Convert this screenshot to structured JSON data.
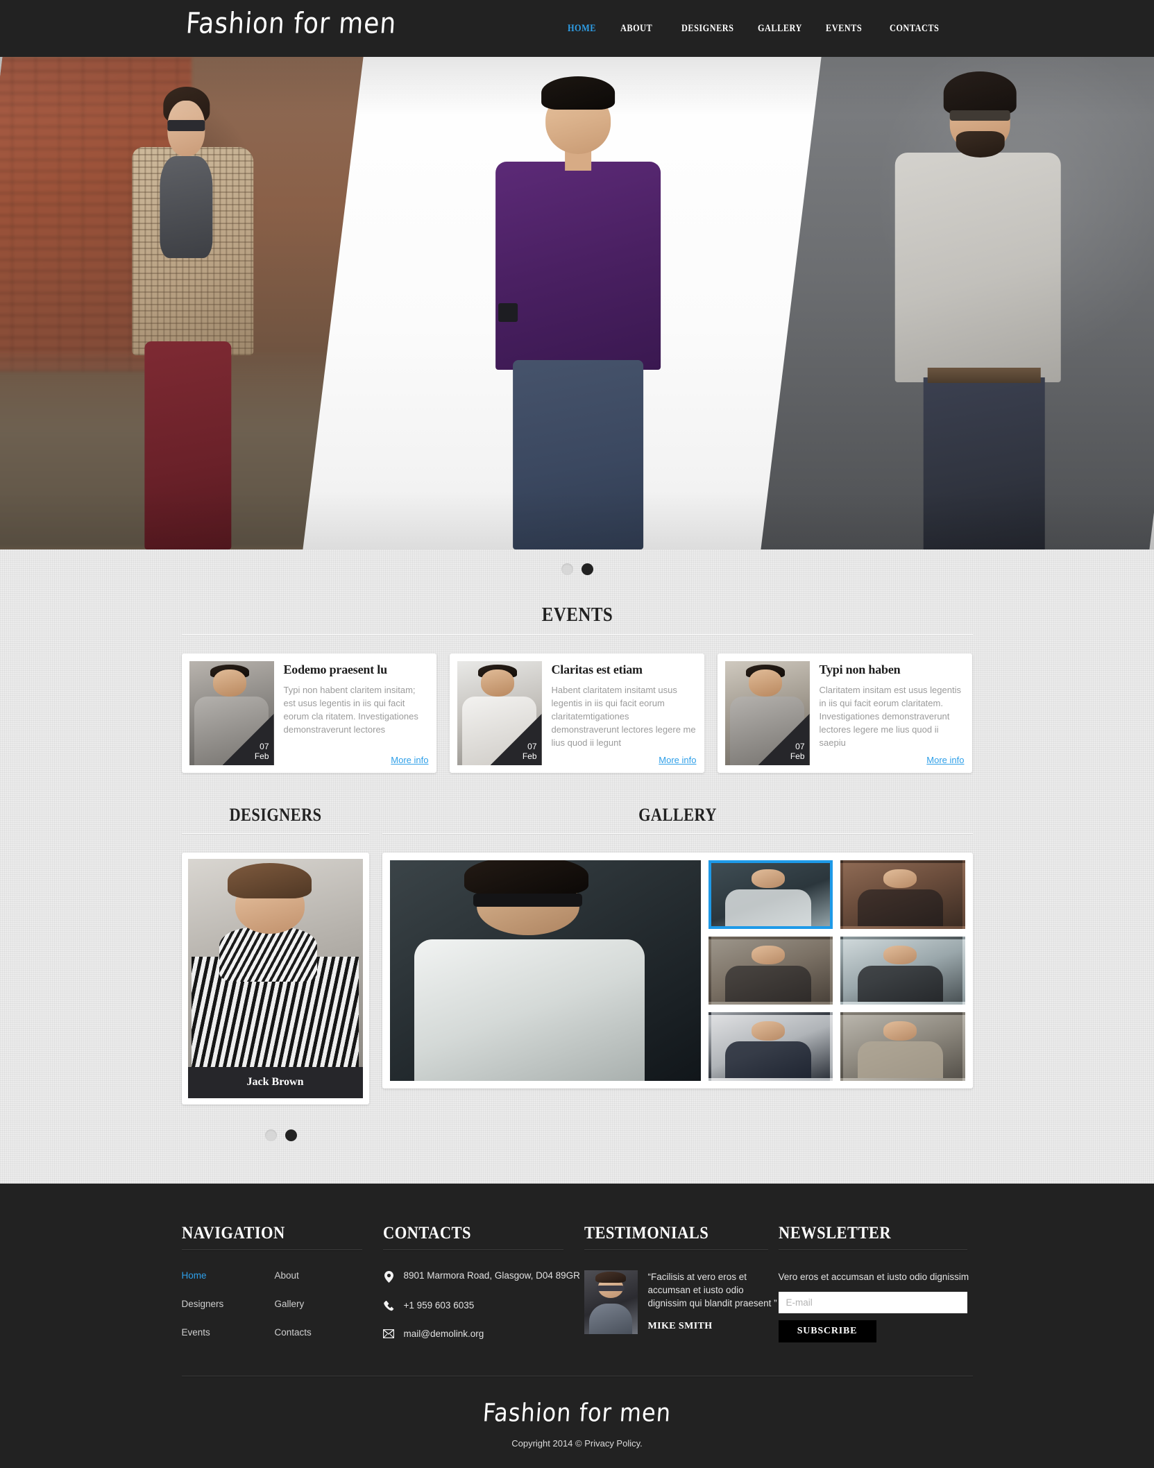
{
  "site": {
    "brand": "Fashion for men",
    "footer_brand": "Fashion for men",
    "copyright": "Copyright 2014 © Privacy Policy.",
    "accent_color": "#2e9fe8",
    "dark_color": "#222222",
    "bg_color": "#ececec"
  },
  "nav": {
    "items": [
      {
        "label": "HOME",
        "active": true
      },
      {
        "label": "ABOUT",
        "active": false
      },
      {
        "label": "DESIGNERS",
        "active": false
      },
      {
        "label": "GALLERY",
        "active": false
      },
      {
        "label": "EVENTS",
        "active": false
      },
      {
        "label": "CONTACTS",
        "active": false
      }
    ]
  },
  "hero": {
    "slides": [
      {
        "alt": "Man in checked blazer and maroon trousers on a brick street"
      },
      {
        "alt": "Man in open purple shirt and jeans on white studio backdrop"
      },
      {
        "alt": "Bearded man in grey cardigan against grey wall"
      }
    ],
    "pager": {
      "dots": 2,
      "active_index": 1
    }
  },
  "events": {
    "title": "EVENTS",
    "cards": [
      {
        "title": "Eodemo praesent lu",
        "text": "Typi non habent claritem insitam; est usus legentis in iis qui facit eorum cla ritatem. Investigationes demonstraverunt lectores",
        "day": "07",
        "month": "Feb",
        "link": "More info",
        "image_alt": "Man in grey knit cardigan"
      },
      {
        "title": "Claritas est etiam",
        "text": "Habent claritatem insitamt usus legentis in iis qui facit eorum claritatemtigationes demonstraverunt lectores legere me lius quod ii legunt",
        "day": "07",
        "month": "Feb",
        "link": "More info",
        "image_alt": "Man pulling off a white tank top"
      },
      {
        "title": "Typi non haben",
        "text": "Claritatem insitam est usus legentis in iis qui facit eorum claritatem. Investigationes demonstraverunt lectores legere me lius quod ii saepiu",
        "day": "07",
        "month": "Feb",
        "link": "More info",
        "image_alt": "Man in grey blazer resting head on hand"
      }
    ]
  },
  "designers": {
    "title": "DESIGNERS",
    "card": {
      "name": "Jack Brown",
      "image_alt": "Man in striped coat and scarf"
    }
  },
  "gallery": {
    "title": "GALLERY",
    "main_image_alt": "Man in white shirt and sunglasses seated",
    "thumbs": [
      {
        "alt": "Man in white shirt with sunglasses",
        "active": true
      },
      {
        "alt": "Man in dark jacket in an alley",
        "active": false
      },
      {
        "alt": "Man in hat with blue tie",
        "active": false
      },
      {
        "alt": "Man in black v-neck sweater",
        "active": false
      },
      {
        "alt": "Man in navy suit",
        "active": false
      },
      {
        "alt": "Man in beige jacket with glasses",
        "active": false
      }
    ]
  },
  "bottom_pager": {
    "dots": 2,
    "active_index": 1
  },
  "footer": {
    "navigation": {
      "title": "NAVIGATION",
      "items": [
        {
          "label": "Home",
          "current": true
        },
        {
          "label": "About",
          "current": false
        },
        {
          "label": "Designers",
          "current": false
        },
        {
          "label": "Gallery",
          "current": false
        },
        {
          "label": "Events",
          "current": false
        },
        {
          "label": "Contacts",
          "current": false
        }
      ]
    },
    "contacts": {
      "title": "CONTACTS",
      "address": "8901 Marmora Road, Glasgow, D04 89GR",
      "phone": "+1 959 603 6035",
      "email": "mail@demolink.org"
    },
    "testimonials": {
      "title": "TESTIMONIALS",
      "quote": "“Facilisis at vero eros et accumsan et iusto odio dignissim qui blandit praesent ”",
      "author": "MIKE SMITH",
      "avatar_alt": "Man with sunglasses and scarf"
    },
    "newsletter": {
      "title": "NEWSLETTER",
      "text": "Vero eros et accumsan et iusto odio dignissim",
      "input_placeholder": "E-mail",
      "input_value": "",
      "button_label": "SUBSCRIBE"
    }
  }
}
